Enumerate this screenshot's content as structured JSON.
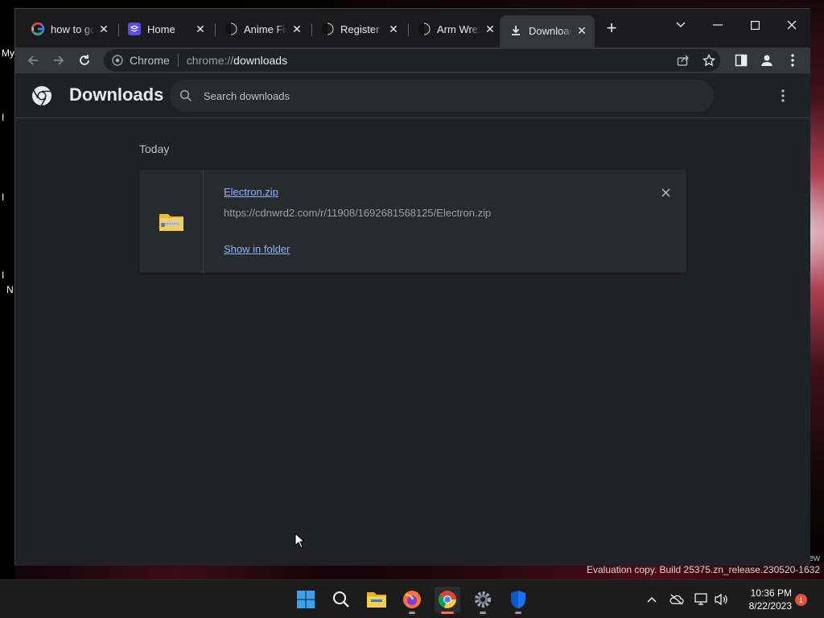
{
  "desktop": {
    "left_labels": [
      "My",
      "I",
      "I",
      "I",
      "N"
    ],
    "eval_text_top": "ew",
    "eval_text": "Evaluation copy. Build 25375.zn_release.230520-1632"
  },
  "browser": {
    "tabs": [
      {
        "title": "how to get",
        "icon": "google-icon",
        "active": false
      },
      {
        "title": "Home",
        "icon": "layers-icon",
        "active": false
      },
      {
        "title": "Anime Fighting",
        "icon": "roblox-icon",
        "active": false
      },
      {
        "title": "Register »",
        "icon": "roblox-icon",
        "active": false
      },
      {
        "title": "Arm Wrestle",
        "icon": "roblox-icon",
        "active": false
      },
      {
        "title": "Downloads",
        "icon": "download-icon",
        "active": true
      }
    ],
    "omnibox": {
      "site_chip": "Chrome",
      "url_scheme": "chrome://",
      "url_host": "downloads"
    }
  },
  "page": {
    "title": "Downloads",
    "search_placeholder": "Search downloads",
    "date_heading": "Today",
    "downloads": [
      {
        "file_name": "Electron.zip",
        "url": "https://cdnwrd2.com/r/11908/1692681568125/Electron.zip",
        "action": "Show in folder"
      }
    ]
  },
  "taskbar": {
    "apps": [
      "windows-start-icon",
      "search-icon",
      "file-explorer-icon",
      "firefox-icon",
      "chrome-icon",
      "settings-icon",
      "defender-icon"
    ],
    "clock": {
      "time": "10:36 PM",
      "date": "8/22/2023"
    },
    "notification_count": "1"
  },
  "colors": {
    "accent_link": "#8ab4f8",
    "background": "#202124"
  }
}
